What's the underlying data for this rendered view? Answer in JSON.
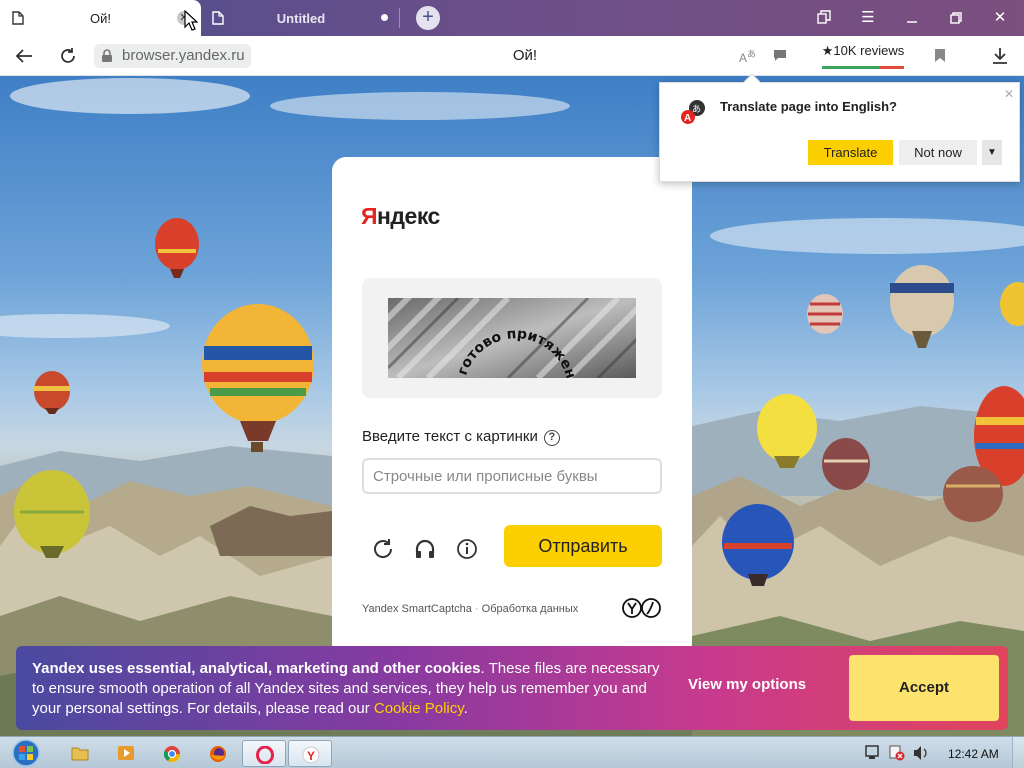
{
  "browser": {
    "tabs": [
      {
        "label": "Ой!",
        "active": true
      },
      {
        "label": "Untitled",
        "active": false
      }
    ],
    "address": {
      "url": "browser.yandex.ru",
      "page_title": "Ой!"
    },
    "reviews_badge": "★10K reviews"
  },
  "translate_popup": {
    "title": "Translate page into English?",
    "translate_label": "Translate",
    "not_now_label": "Not now"
  },
  "captcha": {
    "logo_part1": "Я",
    "logo_part2": "ндекс",
    "captcha_image_text": "готово притяжение",
    "prompt": "Введите текст с картинки",
    "help_glyph": "?",
    "input_value": "",
    "input_placeholder": "Строчные или прописные буквы",
    "submit_label": "Отправить",
    "footer_smartcaptcha": "Yandex SmartCaptcha",
    "footer_sep": " · ",
    "footer_data": "Обработка данных"
  },
  "cookie_banner": {
    "bold_text": "Yandex uses essential, analytical, marketing and other cookies",
    "text": ". These files are necessary to ensure smooth operation of all Yandex sites and services, they help us remember you and your personal settings. For details, please read our ",
    "link": "Cookie Policy",
    "text_end": ".",
    "view_options_label": "View my options",
    "accept_label": "Accept"
  },
  "taskbar": {
    "items": [
      "explorer",
      "media-player",
      "chrome",
      "firefox",
      "opera",
      "yandex-browser"
    ],
    "clock": "12:42 AM"
  },
  "colors": {
    "yandex_yellow": "#fcd000",
    "yandex_red": "#e52620",
    "tab_bar": "#5a4f8c"
  }
}
